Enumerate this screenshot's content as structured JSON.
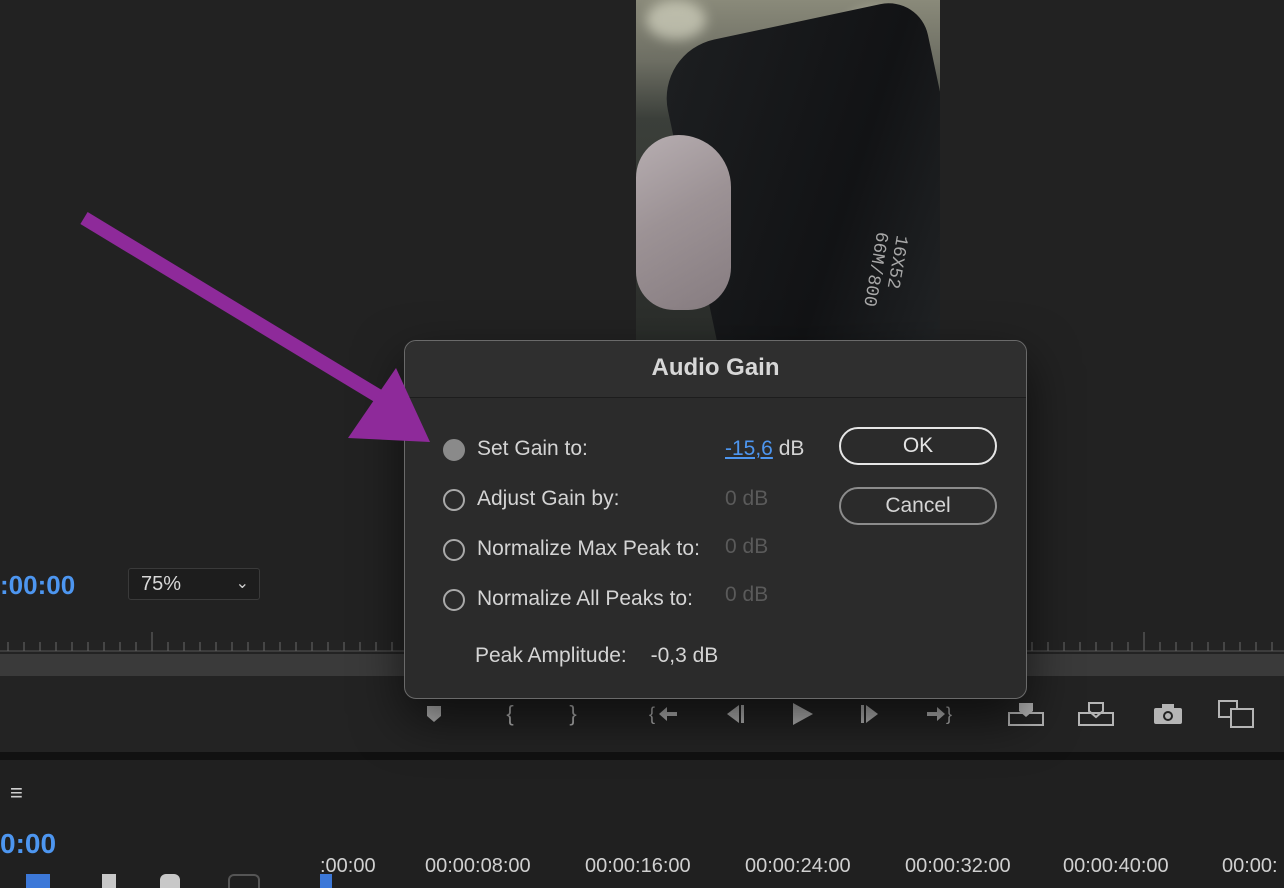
{
  "monitor": {
    "timecode": ":00:00",
    "zoom": "75%",
    "video_text": "16X52\n66M/800"
  },
  "transport": {
    "buttons": [
      "marker-icon",
      "mark-in-icon",
      "mark-out-icon",
      "go-to-in-icon",
      "step-back-icon",
      "play-icon",
      "step-forward-icon",
      "go-to-out-icon",
      "insert-icon",
      "overwrite-icon",
      "camera-icon",
      "compare-icon"
    ]
  },
  "timeline": {
    "menu_icon": "≡",
    "timecode": "0:00",
    "ruler_labels": [
      ":00:00",
      "00:00:08:00",
      "00:00:16:00",
      "00:00:24:00",
      "00:00:32:00",
      "00:00:40:00",
      "00:00:"
    ]
  },
  "dialog": {
    "title": "Audio Gain",
    "options": [
      {
        "label": "Set Gain to:",
        "value": "-15,6",
        "unit": "dB",
        "checked": true
      },
      {
        "label": "Adjust Gain by:",
        "value": "0 dB",
        "checked": false
      },
      {
        "label": "Normalize Max Peak to:",
        "value": "0 dB",
        "checked": false
      },
      {
        "label": "Normalize All Peaks to:",
        "value": "0 dB",
        "checked": false
      }
    ],
    "ok_label": "OK",
    "cancel_label": "Cancel",
    "peak_label": "Peak Amplitude:",
    "peak_value": "-0,3 dB"
  },
  "colors": {
    "accent": "#4d96f0",
    "annotation_arrow": "#8e2a9a",
    "dialog_bg": "#2b2b2b"
  }
}
